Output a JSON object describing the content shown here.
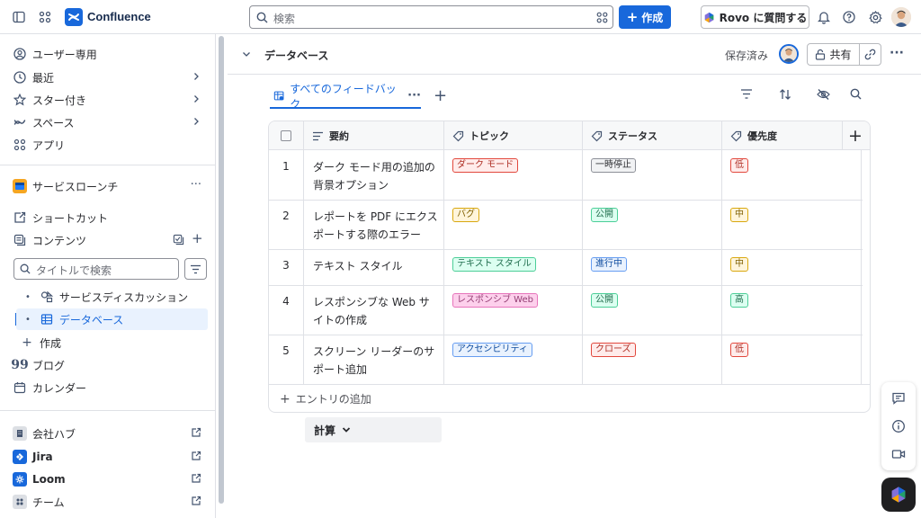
{
  "app": {
    "name": "Confluence"
  },
  "search": {
    "placeholder": "検索"
  },
  "topbar": {
    "create_label": "作成",
    "rovo_label": "Rovo に質問する"
  },
  "sidebar": {
    "nav": [
      {
        "label": "ユーザー専用",
        "icon": "user-circle-icon"
      },
      {
        "label": "最近",
        "icon": "clock-icon"
      },
      {
        "label": "スター付き",
        "icon": "star-icon"
      },
      {
        "label": "スペース",
        "icon": "spaces-icon"
      },
      {
        "label": "アプリ",
        "icon": "apps-icon"
      }
    ],
    "space_name": "サービスローンチ",
    "shortcut_label": "ショートカット",
    "contents_label": "コンテンツ",
    "title_search_placeholder": "タイトルで検索",
    "tree": [
      {
        "label": "サービスディスカッション",
        "icon": "whiteboard-icon"
      },
      {
        "label": "データベース",
        "icon": "database-icon",
        "selected": true
      }
    ],
    "create_label": "作成",
    "blog_label": "ブログ",
    "calendar_label": "カレンダー",
    "apps": [
      {
        "label": "会社ハブ",
        "icon": "company-hub-icon",
        "color": "#44546f"
      },
      {
        "label": "Jira",
        "icon": "jira-icon",
        "color": "#1868db"
      },
      {
        "label": "Loom",
        "icon": "loom-icon",
        "color": "#1868db"
      },
      {
        "label": "チーム",
        "icon": "team-icon",
        "color": "#44546f"
      }
    ]
  },
  "page": {
    "title": "データベース",
    "status": "保存済み",
    "share_label": "共有",
    "view_tab_label": "すべてのフィードバック"
  },
  "table": {
    "columns": [
      "要約",
      "トピック",
      "ステータス",
      "優先度"
    ],
    "rows": [
      {
        "num": "1",
        "summary": "ダーク モード用の追加の背景オプション",
        "topic": "ダーク モード",
        "status": "一時停止",
        "priority": "低"
      },
      {
        "num": "2",
        "summary": "レポートを PDF にエクスポートする際のエラー",
        "topic": "バグ",
        "status": "公開",
        "priority": "中"
      },
      {
        "num": "3",
        "summary": "テキスト スタイル",
        "topic": "テキスト スタイル",
        "status": "進行中",
        "priority": "中"
      },
      {
        "num": "4",
        "summary": "レスポンシブな Web サイトの作成",
        "topic": "レスポンシブ Web",
        "status": "公開",
        "priority": "高"
      },
      {
        "num": "5",
        "summary": "スクリーン リーダーのサポート追加",
        "topic": "アクセシビリティ",
        "status": "クローズ",
        "priority": "低"
      }
    ],
    "add_entry_label": "エントリの追加",
    "calc_label": "計算"
  },
  "colors": {
    "accent": "#1868db",
    "red": {
      "bg": "#ffeceb",
      "border": "#e2483d"
    },
    "yellow": {
      "bg": "#fff5db",
      "border": "#d9a80f"
    },
    "green": {
      "bg": "#dcfff1",
      "border": "#4bce97"
    },
    "blue": {
      "bg": "#e9f2fe",
      "border": "#669df1"
    },
    "magenta": {
      "bg": "#fdd0ec",
      "border": "#e774bb"
    },
    "gray": {
      "bg": "#f1f2f4",
      "border": "#8c8f97"
    }
  }
}
